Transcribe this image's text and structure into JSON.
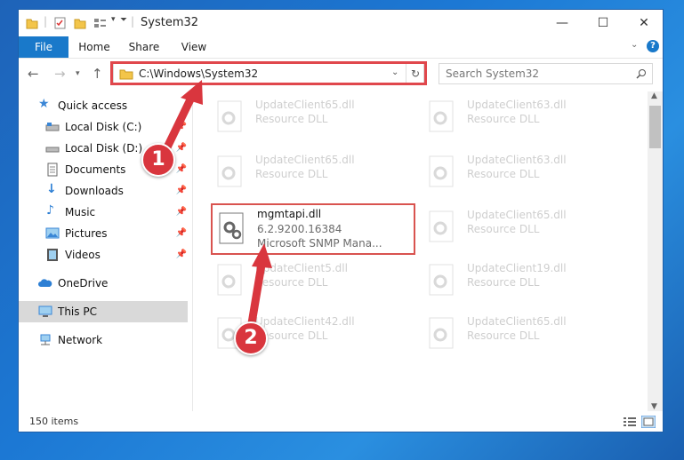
{
  "window": {
    "title": "System32",
    "controls": {
      "minimize": "—",
      "maximize": "☐",
      "close": "✕"
    }
  },
  "ribbon": {
    "tabs": [
      "File",
      "Home",
      "Share",
      "View"
    ],
    "help": "?"
  },
  "address": {
    "path": "C:\\Windows\\System32",
    "search_placeholder": "Search System32"
  },
  "nav": {
    "items": [
      {
        "label": "Quick access",
        "icon": "star-icon"
      },
      {
        "label": "Local Disk (C:)",
        "icon": "drive-icon"
      },
      {
        "label": "Local Disk (D:)",
        "icon": "drive-icon"
      },
      {
        "label": "Documents",
        "icon": "documents-icon"
      },
      {
        "label": "Downloads",
        "icon": "downloads-icon"
      },
      {
        "label": "Music",
        "icon": "music-icon"
      },
      {
        "label": "Pictures",
        "icon": "pictures-icon"
      },
      {
        "label": "Videos",
        "icon": "videos-icon"
      },
      {
        "label": "OneDrive",
        "icon": "cloud-icon"
      },
      {
        "label": "This PC",
        "icon": "computer-icon"
      },
      {
        "label": "Network",
        "icon": "network-icon"
      }
    ]
  },
  "files": {
    "highlighted": {
      "name": "mgmtapi.dll",
      "version": "6.2.9200.16384",
      "description": "Microsoft SNMP Mana..."
    },
    "faded": [
      {
        "name": "UpdateClient65.dll",
        "type": "Resource DLL"
      },
      {
        "name": "UpdateClient63.dll",
        "type": "Resource DLL"
      },
      {
        "name": "UpdateClient65.dll",
        "type": "Resource DLL"
      },
      {
        "name": "UpdateClient63.dll",
        "type": "Resource DLL"
      },
      {
        "name": "UpdateClient65.dll",
        "type": "Resource DLL"
      },
      {
        "name": "UpdateClient5.dll",
        "type": "Resource DLL"
      },
      {
        "name": "UpdateClient19.dll",
        "type": "Resource DLL"
      },
      {
        "name": "UpdateClient42.dll",
        "type": "Resource DLL"
      },
      {
        "name": "UpdateClient65.dll",
        "type": "Resource DLL"
      }
    ]
  },
  "status": {
    "count": "150 items"
  },
  "annotations": {
    "step1": "1",
    "step2": "2"
  },
  "colors": {
    "accent": "#1979ca",
    "annotation": "#d9363e"
  }
}
